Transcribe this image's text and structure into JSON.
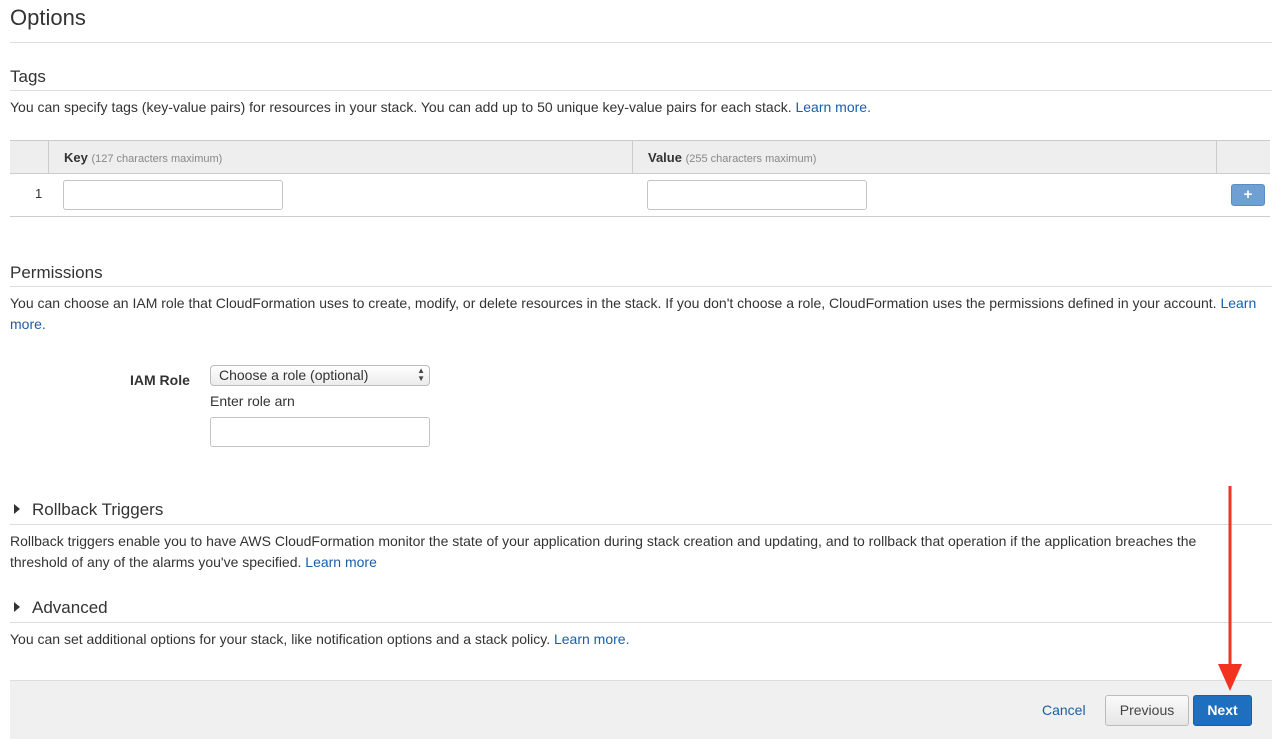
{
  "page": {
    "title": "Options"
  },
  "tags": {
    "title": "Tags",
    "description": "You can specify tags (key-value pairs) for resources in your stack. You can add up to 50 unique key-value pairs for each stack.",
    "learn_more": "Learn more.",
    "columns": {
      "key_label": "Key",
      "key_hint": "(127 characters maximum)",
      "value_label": "Value",
      "value_hint": "(255 characters maximum)"
    },
    "rows": [
      {
        "number": "1",
        "key": "",
        "value": ""
      }
    ],
    "add_button": "+"
  },
  "permissions": {
    "title": "Permissions",
    "description": "You can choose an IAM role that CloudFormation uses to create, modify, or delete resources in the stack. If you don't choose a role, CloudFormation uses the permissions defined in your account.",
    "learn_more": "Learn more.",
    "iam_role_label": "IAM Role",
    "select_value": "Choose a role (optional)",
    "enter_arn_label": "Enter role arn",
    "arn_value": ""
  },
  "rollback": {
    "title": "Rollback Triggers",
    "description": "Rollback triggers enable you to have AWS CloudFormation monitor the state of your application during stack creation and updating, and to rollback that operation if the application breaches the threshold of any of the alarms you've specified.",
    "learn_more": "Learn more"
  },
  "advanced": {
    "title": "Advanced",
    "description": "You can set additional options for your stack, like notification options and a stack policy.",
    "learn_more": "Learn more."
  },
  "footer": {
    "cancel": "Cancel",
    "previous": "Previous",
    "next": "Next"
  },
  "colors": {
    "link": "#1a5ea8",
    "primary_button": "#1f6fc0",
    "annotation_arrow": "#f2331f"
  },
  "icons": {
    "add": "plus-icon",
    "collapse": "caret-right-icon",
    "select": "select-arrows-icon",
    "annotation": "red-down-arrow"
  }
}
